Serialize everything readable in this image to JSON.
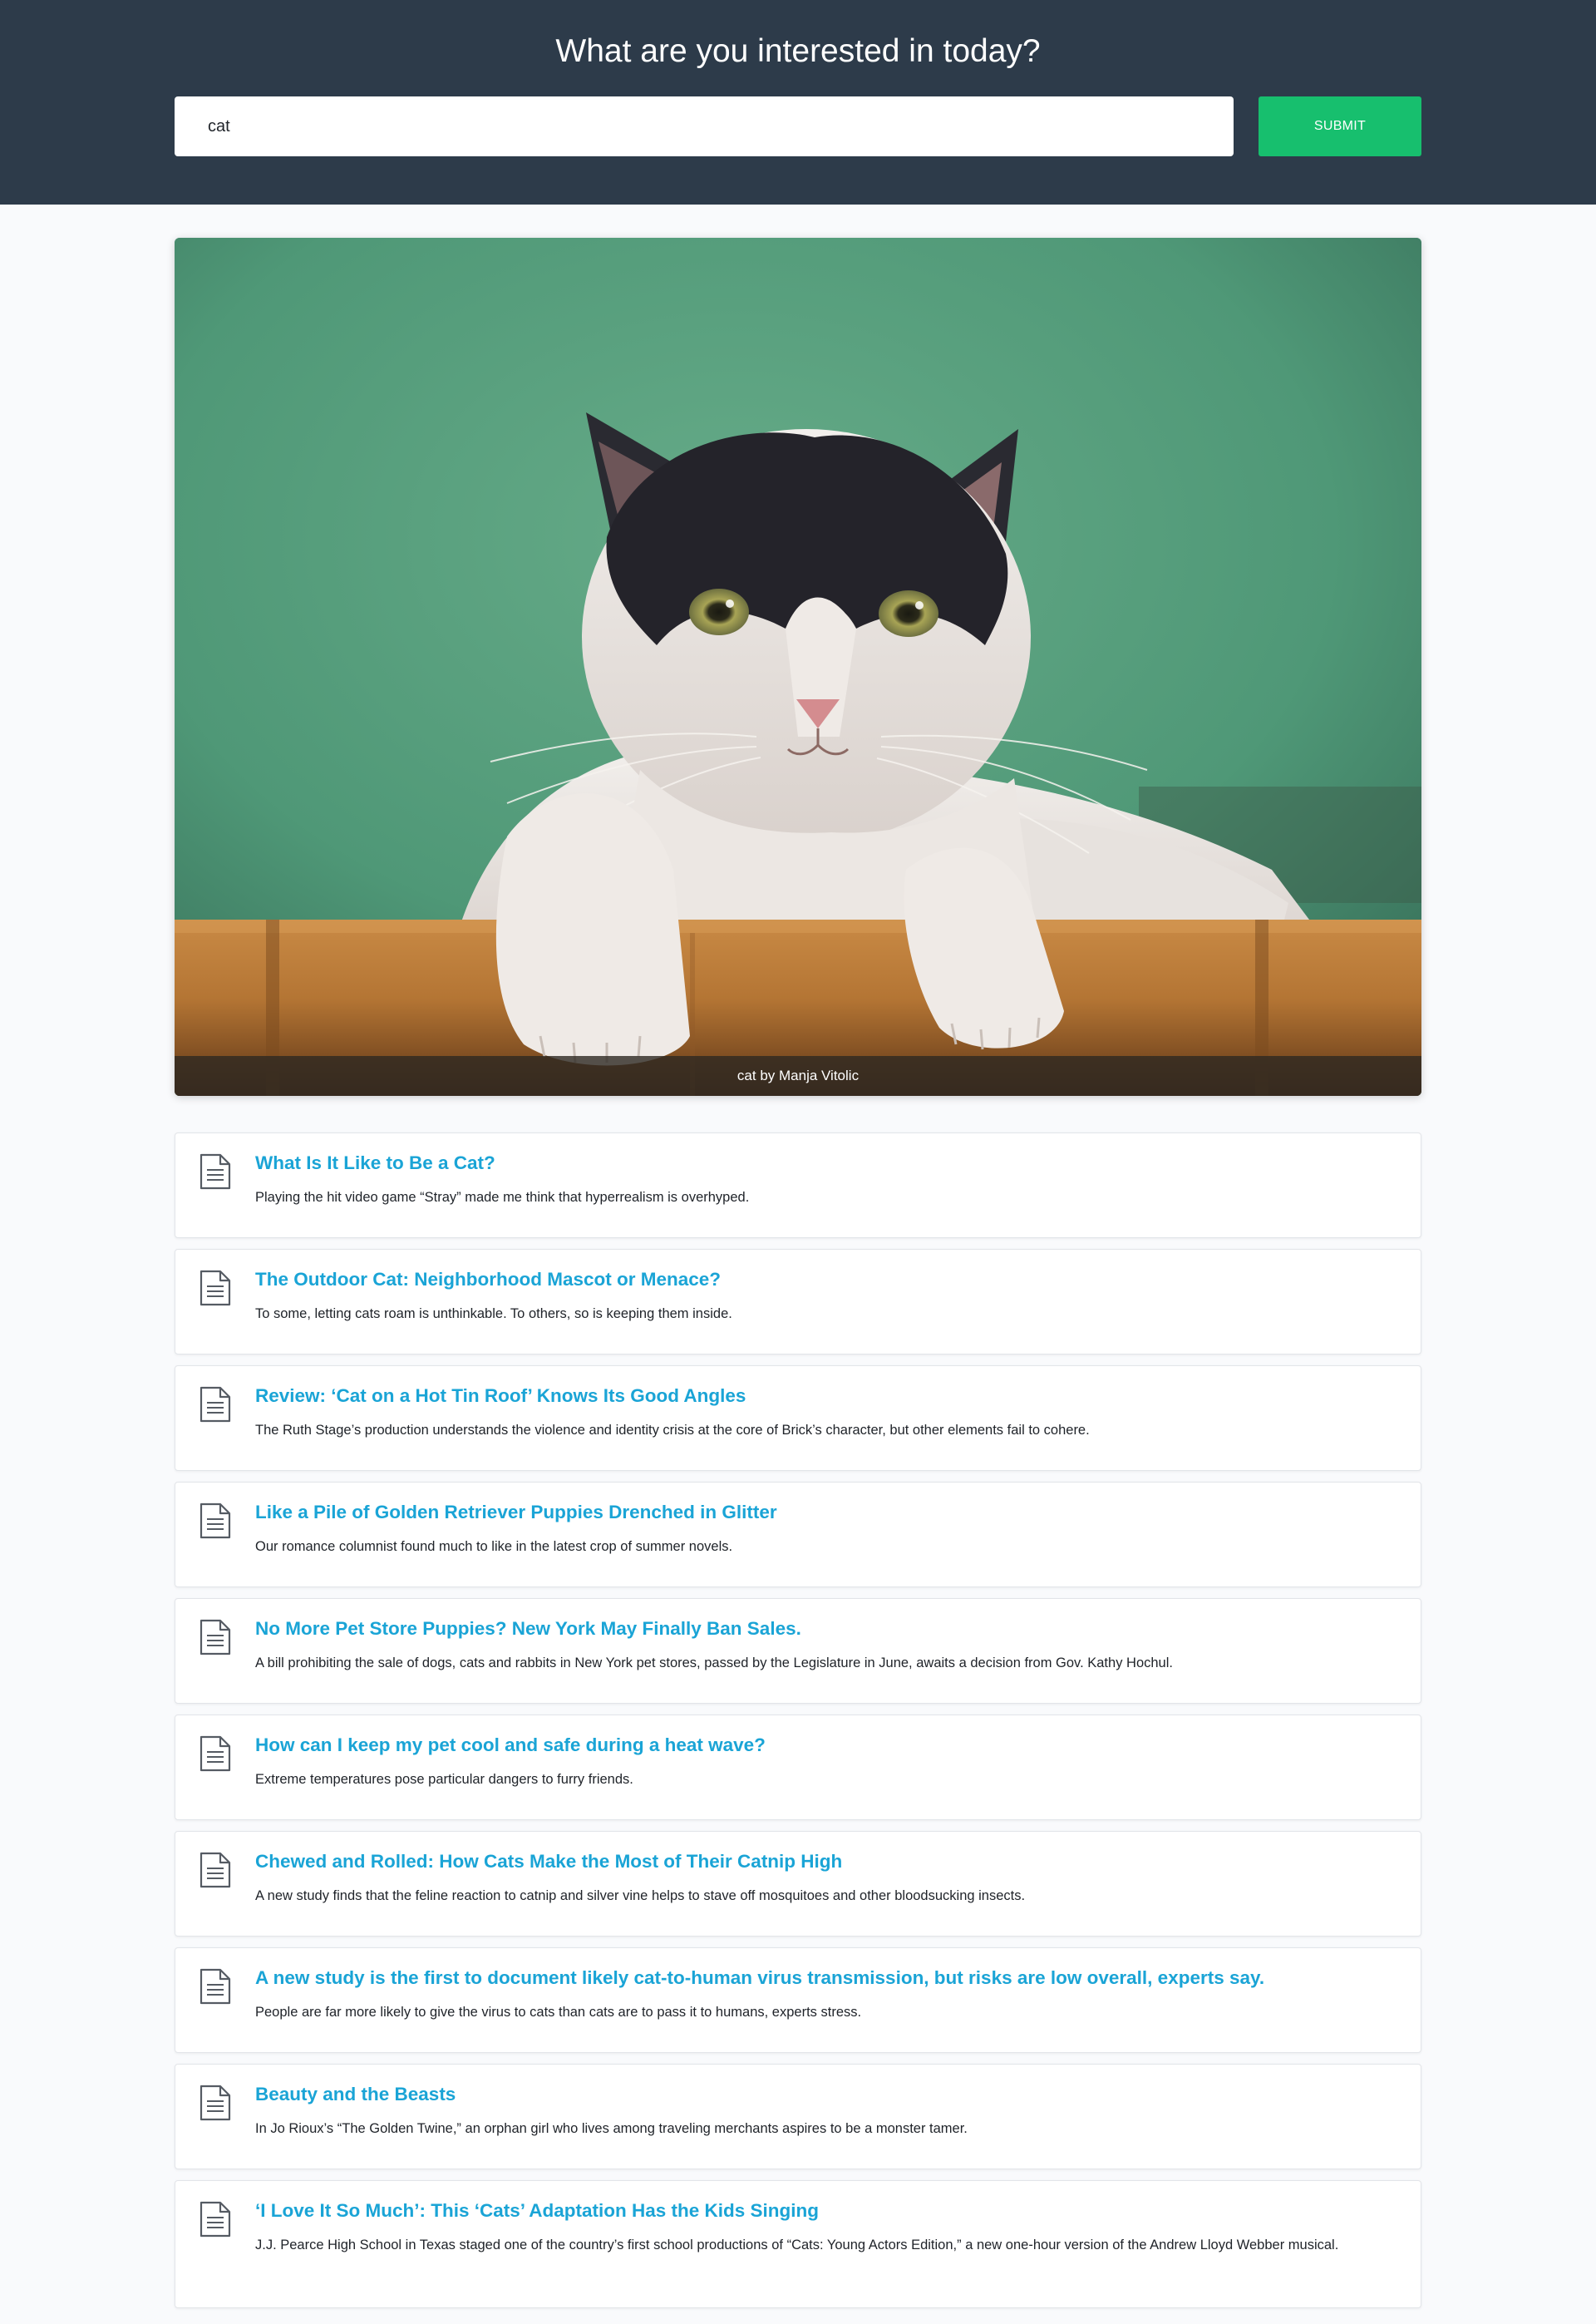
{
  "header": {
    "title": "What are you interested in today?",
    "search_value": "cat",
    "submit_label": "SUBMIT"
  },
  "hero": {
    "caption": "cat by Manja Vitolic"
  },
  "results": [
    {
      "title": "What Is It Like to Be a Cat?",
      "description": "Playing the hit video game “Stray” made me think that hyperrealism is overhyped."
    },
    {
      "title": "The Outdoor Cat: Neighborhood Mascot or Menace?",
      "description": "To some, letting cats roam is unthinkable. To others, so is keeping them inside."
    },
    {
      "title": "Review: ‘Cat on a Hot Tin Roof’ Knows Its Good Angles",
      "description": "The Ruth Stage’s production understands the violence and identity crisis at the core of Brick’s character, but other elements fail to cohere."
    },
    {
      "title": "Like a Pile of Golden Retriever Puppies Drenched in Glitter",
      "description": "Our romance columnist found much to like in the latest crop of summer novels."
    },
    {
      "title": "No More Pet Store Puppies? New York May Finally Ban Sales.",
      "description": "A bill prohibiting the sale of dogs, cats and rabbits in New York pet stores, passed by the Legislature in June, awaits a decision from Gov. Kathy Hochul."
    },
    {
      "title": "How can I keep my pet cool and safe during a heat wave?",
      "description": "Extreme temperatures pose particular dangers to furry friends."
    },
    {
      "title": "Chewed and Rolled: How Cats Make the Most of Their Catnip High",
      "description": "A new study finds that the feline reaction to catnip and silver vine helps to stave off mosquitoes and other bloodsucking insects."
    },
    {
      "title": "A new study is the first to document likely cat-to-human virus transmission, but risks are low overall, experts say.",
      "description": "People are far more likely to give the virus to cats than cats are to pass it to humans, experts stress."
    },
    {
      "title": "Beauty and the Beasts",
      "description": "In Jo Rioux’s “The Golden Twine,” an orphan girl who lives among traveling merchants aspires to be a monster tamer."
    },
    {
      "title": "‘I Love It So Much’: This ‘Cats’ Adaptation Has the Kids Singing",
      "description": "J.J. Pearce High School in Texas staged one of the country’s first school productions of “Cats: Young Actors Edition,” a new one-hour version of the Andrew Lloyd Webber musical."
    }
  ],
  "icons": {
    "result_icon": "document-icon"
  },
  "colors": {
    "header_bg": "#2d3b4a",
    "submit_bg": "#17bf6e",
    "link": "#1aa4d6"
  }
}
